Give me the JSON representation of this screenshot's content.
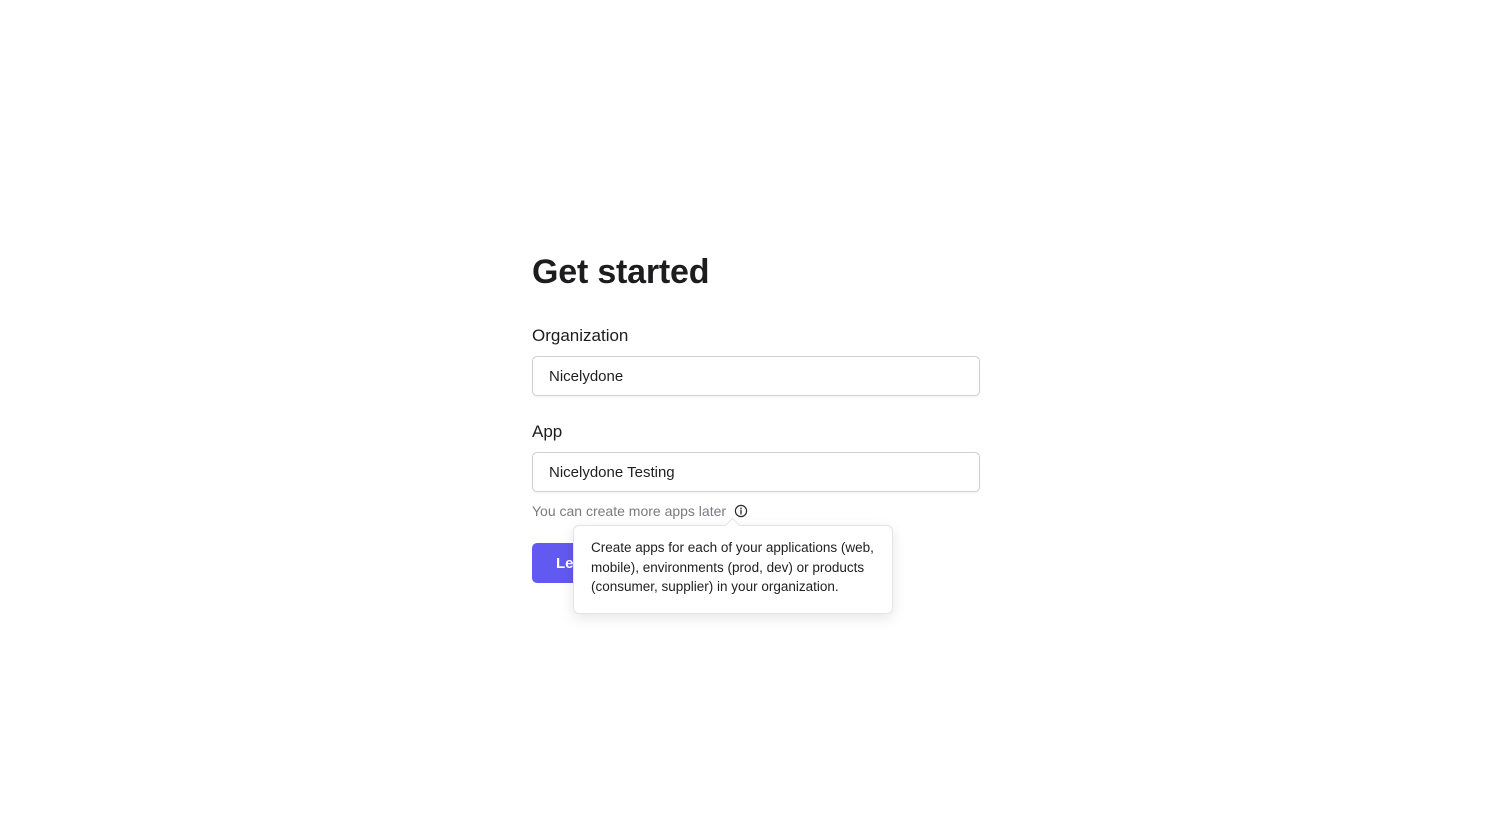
{
  "page": {
    "title": "Get started"
  },
  "organization": {
    "label": "Organization",
    "value": "Nicelydone"
  },
  "app": {
    "label": "App",
    "value": "Nicelydone Testing",
    "hint": "You can create more apps later"
  },
  "submit": {
    "label": "Let's go"
  },
  "tooltip": {
    "text": "Create apps for each of your applications (web, mobile), environments (prod, dev) or products (consumer, supplier) in your organization."
  },
  "icons": {
    "info": "info-circle-icon"
  },
  "colors": {
    "accent": "#6259f1",
    "hint": "#7a7a80",
    "input_border": "#cfcfd4"
  }
}
